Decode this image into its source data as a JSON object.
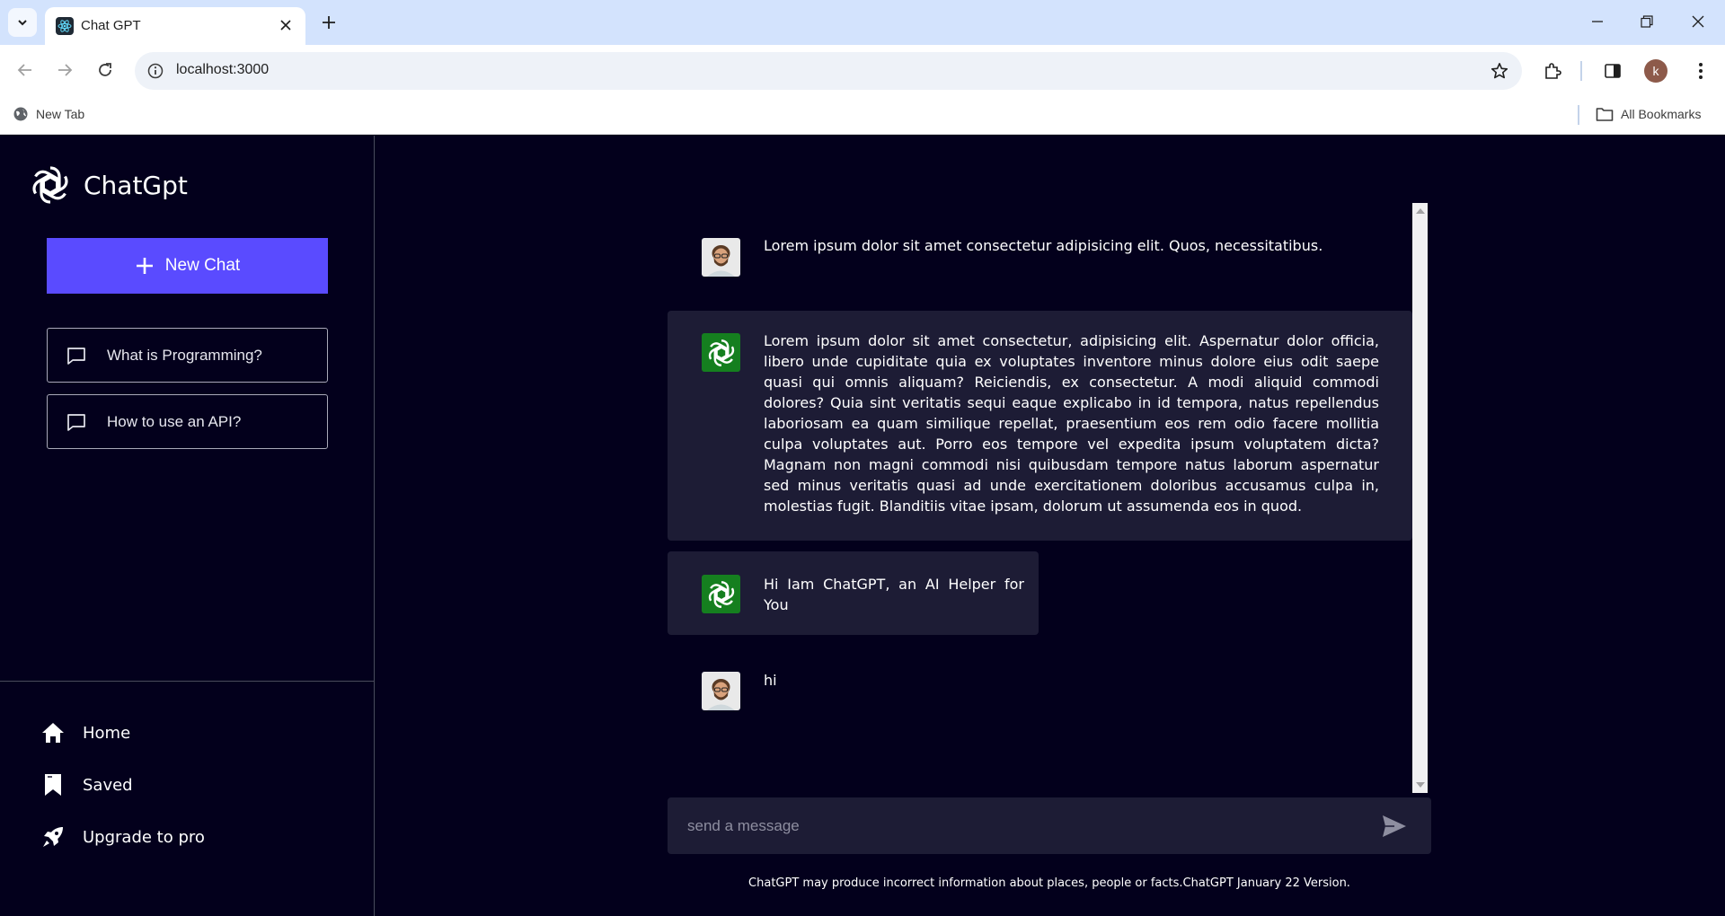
{
  "browser": {
    "tab_title": "Chat GPT",
    "url": "localhost:3000",
    "profile_initial": "k",
    "bookmarks": {
      "new_tab": "New Tab",
      "all_bookmarks": "All Bookmarks"
    }
  },
  "sidebar": {
    "brand": "ChatGpt",
    "new_chat": "New Chat",
    "queries": [
      {
        "label": "What is Programming?"
      },
      {
        "label": "How to use an API?"
      }
    ],
    "lower_items": [
      {
        "label": "Home",
        "icon": "home-icon"
      },
      {
        "label": "Saved",
        "icon": "bookmark-icon"
      },
      {
        "label": "Upgrade to pro",
        "icon": "rocket-icon"
      }
    ]
  },
  "chat": {
    "messages": [
      {
        "role": "user",
        "text": "Lorem ipsum dolor sit amet consectetur adipisicing elit. Quos, necessitatibus."
      },
      {
        "role": "bot",
        "text": "Lorem ipsum dolor sit amet consectetur, adipisicing elit. Aspernatur dolor officia, libero unde cupiditate quia ex voluptates inventore minus dolore eius odit saepe quasi qui omnis aliquam? Reiciendis, ex consectetur. A modi aliquid commodi dolores? Quia sint veritatis sequi eaque explicabo in id tempora, natus repellendus laboriosam ea quam similique repellat, praesentium eos rem odio facere mollitia culpa voluptates aut. Porro eos tempore vel expedita ipsum voluptatem dicta? Magnam non magni commodi nisi quibusdam tempore natus laborum aspernatur sed minus veritatis quasi ad unde exercitationem doloribus accusamus culpa in, molestias fugit. Blanditiis vitae ipsam, dolorum ut assumenda eos in quod."
      },
      {
        "role": "bot",
        "text": "Hi Iam ChatGPT, an AI Helper for You"
      },
      {
        "role": "user",
        "text": "hi"
      }
    ],
    "input_placeholder": "send a message",
    "input_value": "",
    "footer": "ChatGPT may produce incorrect information about places, people or facts.ChatGPT January 22 Version."
  },
  "colors": {
    "background": "#03001c",
    "accent": "#5a4bff",
    "bot_bubble": "#1d1c35",
    "gpt_avatar": "#157f1f"
  }
}
